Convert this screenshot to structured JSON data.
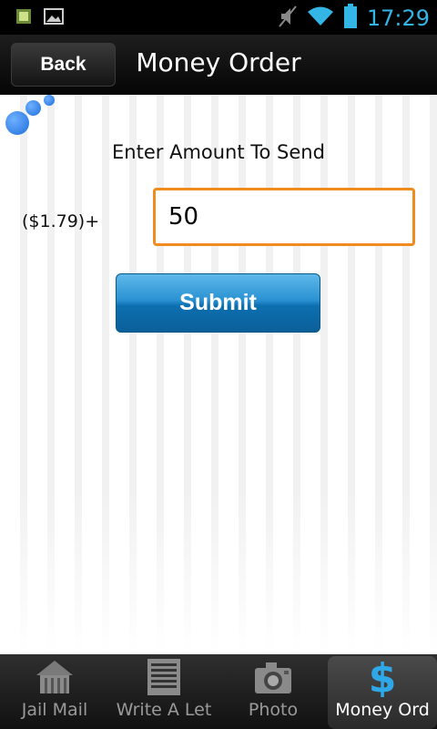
{
  "status_bar": {
    "time": "17:29",
    "icons": [
      "notification-icon",
      "gallery-icon",
      "mute-icon",
      "wifi-icon",
      "battery-icon"
    ],
    "accent": "#33b5e5"
  },
  "header": {
    "back_label": "Back",
    "title": "Money Order"
  },
  "form": {
    "prompt": "Enter Amount To Send",
    "fee_label": "($1.79)+",
    "amount_value": "50",
    "submit_label": "Submit",
    "input_border_color": "#f08c1e",
    "button_color": "#2a92d2"
  },
  "tabs": [
    {
      "label": "Jail Mail",
      "icon": "jail-icon",
      "active": false
    },
    {
      "label": "Write A Let",
      "icon": "letter-icon",
      "active": false
    },
    {
      "label": "Photo",
      "icon": "camera-icon",
      "active": false
    },
    {
      "label": "Money Ord",
      "icon": "dollar-icon",
      "active": true
    }
  ]
}
